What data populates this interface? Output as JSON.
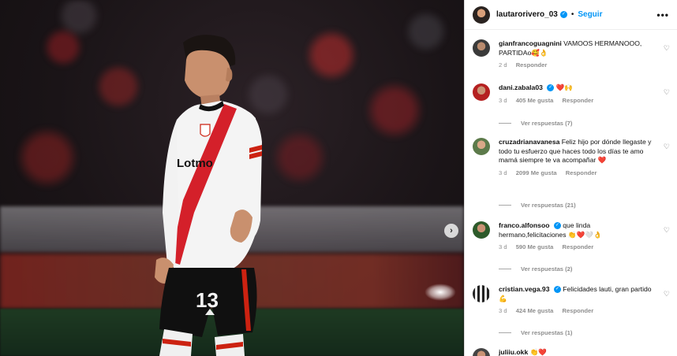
{
  "post": {
    "username": "lautarorivero_03",
    "follow_label": "Seguir",
    "separator": "•",
    "more_label": "•••",
    "next_label": "›",
    "jersey_number": "13",
    "jersey_sponsor": "Lotmo"
  },
  "comments": [
    {
      "username": "gianfrancoguagnini",
      "text": "VAMOOS HERMANOOO, PARTIDAo🥰👌",
      "time": "2 d",
      "likes": "",
      "reply_label": "Responder",
      "view_replies": ""
    },
    {
      "username": "dani.zabala03",
      "verified": true,
      "text": "❤️🙌",
      "time": "3 d",
      "likes": "405 Me gusta",
      "reply_label": "Responder",
      "view_replies": "Ver respuestas (7)"
    },
    {
      "username": "cruzadrianavanesa",
      "text": "Feliz hijo por dónde llegaste y todo tu esfuerzo que haces todo los días te amo mamá siempre te va acompañar ❤️",
      "time": "3 d",
      "likes": "2099 Me gusta",
      "reply_label": "Responder",
      "view_replies": "Ver respuestas (21)"
    },
    {
      "username": "franco.alfonsoo",
      "verified": true,
      "text": "que linda hermano,felicitaciones 👏❤️🤍👌",
      "time": "3 d",
      "likes": "590 Me gusta",
      "reply_label": "Responder",
      "view_replies": "Ver respuestas (2)"
    },
    {
      "username": "cristian.vega.93",
      "verified": true,
      "text": "Felicidades lauti, gran partido 💪",
      "time": "3 d",
      "likes": "424 Me gusta",
      "reply_label": "Responder",
      "view_replies": "Ver respuestas (1)"
    },
    {
      "username": "juliiu.okk",
      "text": "👏❤️",
      "time": "",
      "likes": "",
      "reply_label": "",
      "view_replies": ""
    }
  ],
  "colors": {
    "accent": "#0095f6",
    "muted": "#8e8e8e",
    "heart_red": "#e0245e"
  },
  "icons": [
    "verified-badge-icon",
    "heart-outline-icon",
    "more-options-icon",
    "carousel-next-icon"
  ]
}
